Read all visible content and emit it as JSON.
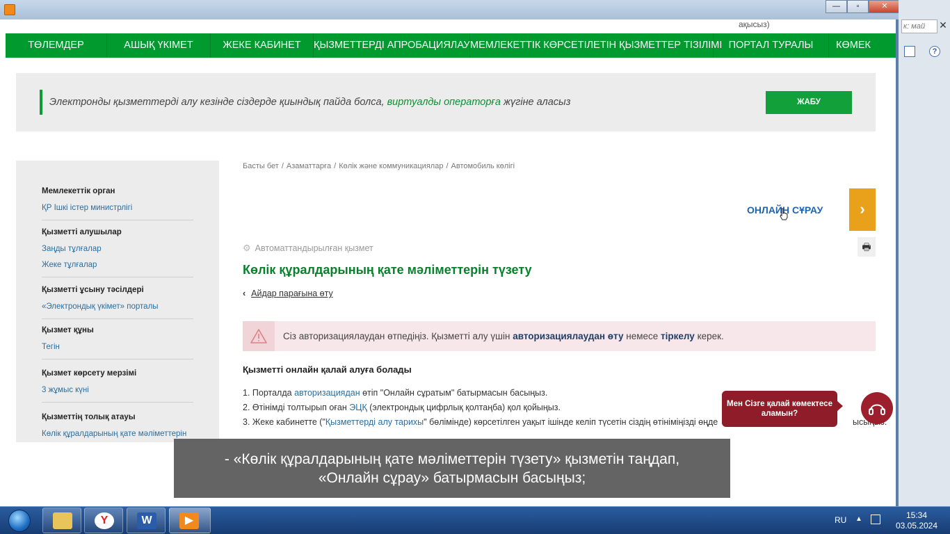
{
  "desktop": {
    "right_strip_search_placeholder": "к: май"
  },
  "page": {
    "top_fragment": "ақысыз)",
    "menu": [
      "ТӨЛЕМДЕР",
      "АШЫҚ ҮКІМЕТ",
      "ЖЕКЕ КАБИНЕТ",
      "ҚЫЗМЕТТЕРДІ АПРОБАЦИЯЛАУ",
      "МЕМЛЕКЕТТІК КӨРСЕТІЛЕТІН ҚЫЗМЕТТЕР ТІЗІЛІМІ",
      "ПОРТАЛ ТУРАЛЫ",
      "КӨМЕК"
    ],
    "notice": {
      "text_before": "Электронды қызметтерді алу кезінде сіздерде қиындық пайда болса, ",
      "link": "виртуалды операторға",
      "text_after": " жүгіне аласыз",
      "close_label": "ЖАБУ"
    },
    "sidebar": [
      {
        "heading": "Мемлекеттік орган",
        "values": [
          "ҚР Ішкі істер министрлігі"
        ],
        "links": true
      },
      {
        "heading": "Қызметті алушылар",
        "values": [
          "Заңды тұлғалар",
          "Жеке тұлғалар"
        ],
        "links": true
      },
      {
        "heading": "Қызметті ұсыну тәсілдері",
        "values": [
          "«Электрондық үкімет» порталы"
        ],
        "links": true
      },
      {
        "heading": "Қызмет құны",
        "values": [
          "Тегін"
        ],
        "links": true
      },
      {
        "heading": "Қызмет көрсету мерзімі",
        "values": [
          "3 жұмыс күні"
        ],
        "links": true
      },
      {
        "heading": "Қызметтің толық атауы",
        "values": [
          "Көлік құралдарының қате мәліметтерін"
        ],
        "links": true
      }
    ],
    "breadcrumb": [
      "Басты бет",
      "Азаматтарға",
      "Көлік және коммуникациялар",
      "Автомобиль көлігі"
    ],
    "online_request": "ОНЛАЙН СҰРАУ",
    "online_arrow": "›",
    "auto_label": "Автоматтандырылған қызмет",
    "title": "Көлік құралдарының қате мәліметтерін түзету",
    "back_link": "Айдар парағына өту",
    "alert": {
      "before": "Сіз авторизациялаудан өтпедіңіз. Қызметті алу үшін ",
      "link1": "авторизациялаудан өту",
      "middle": " немесе ",
      "link2": "тіркелу",
      "after": " керек."
    },
    "how_title": "Қызметті онлайн қалай алуға болады",
    "steps": {
      "s1_a": "1. Порталда ",
      "s1_link": "авторизациядан",
      "s1_b": " өтіп \"Онлайн сұратым\" батырмасын басыңыз.",
      "s2_a": "2. Өтінімді толтырып оған ",
      "s2_link": "ЭЦҚ",
      "s2_b": " (электрондық цифрлық қолтаңба) қол қойыңыз.",
      "s3_a": "3. Жеке кабинетте (\"",
      "s3_link": "Қызметтерді алу тарихы",
      "s3_b": "\" бөлімінде) көрсетілген уақыт ішінде келіп түсетін сіздің өтініміңізді өңде",
      "s3_tail": "ысыңыз."
    },
    "help_bubble": "Мен Сізге қалай көмектесе аламын?"
  },
  "subtitle": {
    "line1": "- «Көлік құралдарының қате мәліметтерін түзету» қызметін таңдап,",
    "line2": "«Онлайн сұрау» батырмасын басыңыз;"
  },
  "taskbar": {
    "lang": "RU",
    "time": "15:34",
    "date": "03.05.2024"
  },
  "colors": {
    "menu_green": "#009a2f",
    "title_green": "#0a7f2c",
    "orange": "#e9a11b",
    "help_red": "#8f1d29",
    "link_blue": "#2a6ea0"
  }
}
